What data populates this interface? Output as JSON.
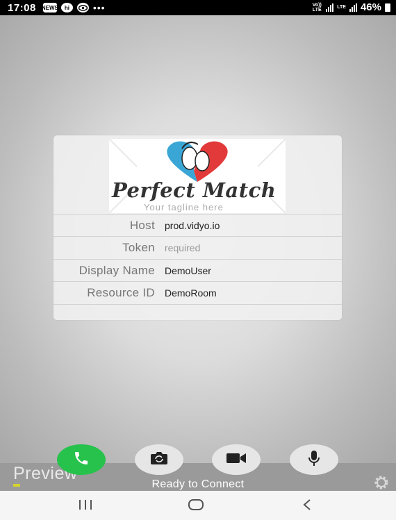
{
  "status_bar": {
    "time": "17:08",
    "notification_icons": [
      "NEWS",
      "hi",
      "wifi-eye"
    ],
    "overflow": "•••",
    "network_1": "Vo)) LTE",
    "network_2": "LTE",
    "battery": "46%"
  },
  "login_card": {
    "logo": {
      "title": "Perfect Match",
      "tagline": "Your tagline here",
      "colors": {
        "left_face": "#3aa6d6",
        "right_face": "#e23a3a"
      }
    },
    "fields": [
      {
        "label": "Host",
        "value": "prod.vidyo.io",
        "placeholder": ""
      },
      {
        "label": "Token",
        "value": "",
        "placeholder": "required"
      },
      {
        "label": "Display Name",
        "value": "DemoUser",
        "placeholder": ""
      },
      {
        "label": "Resource ID",
        "value": "DemoRoom",
        "placeholder": ""
      }
    ]
  },
  "toolbar": {
    "preview_label": "Preview",
    "status": "Ready to Connect",
    "buttons": [
      "call-icon",
      "camera-switch-icon",
      "video-camera-icon",
      "microphone-icon"
    ],
    "call_color": "#27c24c"
  },
  "nav_bar": {
    "buttons": [
      "recent-apps-icon",
      "home-icon",
      "back-icon"
    ]
  }
}
